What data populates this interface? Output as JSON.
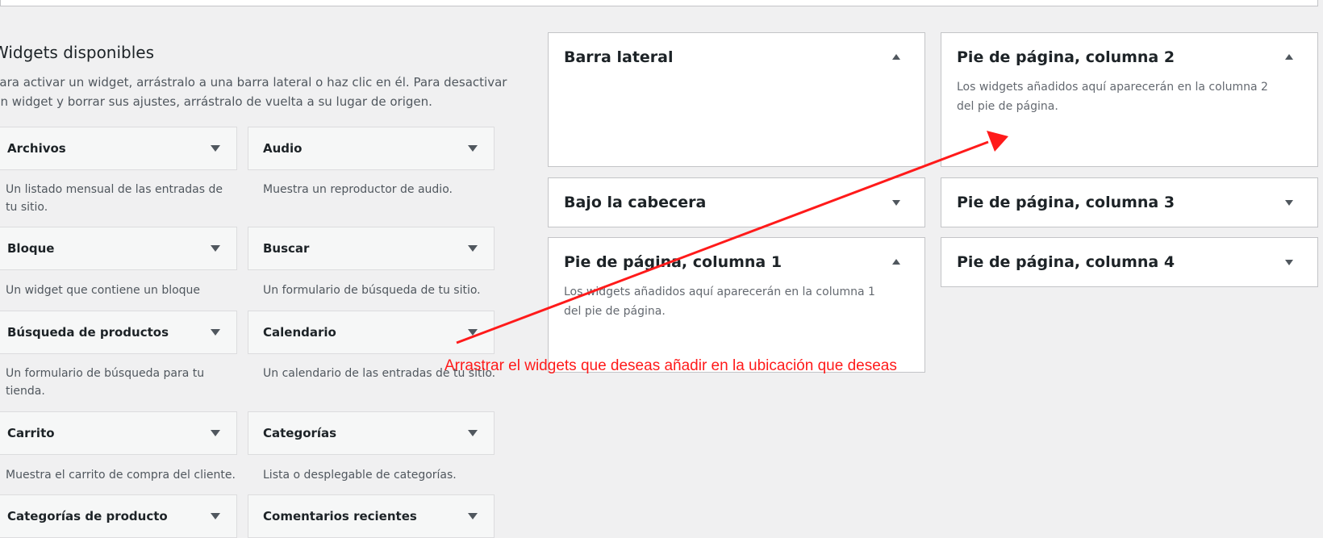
{
  "available": {
    "title": "Widgets disponibles",
    "description": "Para activar un widget, arrástralo a una barra lateral o haz clic en él. Para desactivar un widget y borrar sus ajustes, arrástralo de vuelta a su lugar de origen."
  },
  "widgets": [
    {
      "title": "Archivos",
      "description": "Un listado mensual de las entradas de tu sitio."
    },
    {
      "title": "Audio",
      "description": "Muestra un reproductor de audio."
    },
    {
      "title": "Bloque",
      "description": "Un widget que contiene un bloque"
    },
    {
      "title": "Buscar",
      "description": "Un formulario de búsqueda de tu sitio."
    },
    {
      "title": "Búsqueda de productos",
      "description": "Un formulario de búsqueda para tu tienda."
    },
    {
      "title": "Calendario",
      "description": "Un calendario de las entradas de tu sitio."
    },
    {
      "title": "Carrito",
      "description": "Muestra el carrito de compra del cliente."
    },
    {
      "title": "Categorías",
      "description": "Lista o desplegable de categorías."
    },
    {
      "title": "Categorías de producto",
      "description": ""
    },
    {
      "title": "Comentarios recientes",
      "description": ""
    }
  ],
  "areas": [
    {
      "title": "Barra lateral",
      "description": "",
      "state": "expanded"
    },
    {
      "title": "Bajo la cabecera",
      "description": "",
      "state": "collapsed"
    },
    {
      "title": "Pie de página, columna 1",
      "description": "Los widgets añadidos aquí aparecerán en la columna 1 del pie de página.",
      "state": "expanded"
    },
    {
      "title": "Pie de página, columna 2",
      "description": "Los widgets añadidos aquí aparecerán en la columna 2 del pie de página.",
      "state": "expanded"
    },
    {
      "title": "Pie de página, columna 3",
      "description": "",
      "state": "collapsed"
    },
    {
      "title": "Pie de página, columna 4",
      "description": "",
      "state": "collapsed"
    }
  ],
  "annotation": {
    "text": "Arrastrar el widgets que deseas añadir en la ubicación que deseas",
    "color": "#ff1a1a"
  },
  "icons": {
    "collapsed": "chevron-down-icon",
    "expanded": "chevron-up-icon"
  }
}
